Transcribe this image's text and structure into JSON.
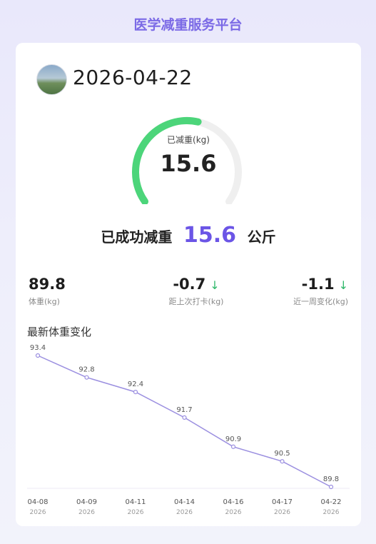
{
  "app": {
    "title": "医学减重服务平台"
  },
  "header": {
    "date": "2026-04-22"
  },
  "gauge": {
    "label": "已减重(kg)",
    "value": "15.6",
    "progress": 0.55
  },
  "summary": {
    "prefix": "已成功减重",
    "value": "15.6",
    "unit": "公斤"
  },
  "stats": [
    {
      "value": "89.8",
      "label": "体重(kg)",
      "trend": ""
    },
    {
      "value": "-0.7",
      "label": "距上次打卡(kg)",
      "trend": "↓"
    },
    {
      "value": "-1.1",
      "label": "近一周变化(kg)",
      "trend": "↓"
    }
  ],
  "colors": {
    "accent": "#7b6ae6",
    "gauge": "#4cd57a",
    "line": "#9b8fe0",
    "down": "#2fb86a"
  },
  "chart_title": "最新体重变化",
  "chart_data": {
    "type": "line",
    "categories": [
      "04-08",
      "04-09",
      "04-11",
      "04-14",
      "04-16",
      "04-17",
      "04-22"
    ],
    "years": [
      "2026",
      "2026",
      "2026",
      "2026",
      "2026",
      "2026",
      "2026"
    ],
    "values": [
      93.4,
      92.8,
      92.4,
      91.7,
      90.9,
      90.5,
      89.8
    ],
    "ylim": [
      89.8,
      93.4
    ],
    "grid": false,
    "title": "",
    "xlabel": "",
    "ylabel": ""
  }
}
